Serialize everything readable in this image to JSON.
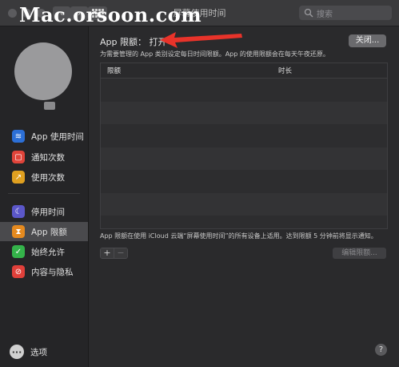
{
  "window": {
    "title": "屏幕使用时间",
    "search_placeholder": "搜索",
    "back_glyph": "‹",
    "forward_glyph": "›"
  },
  "watermark": "Mac.orsoon.com",
  "sidebar": {
    "items": [
      {
        "label": "App 使用时间",
        "icon": "layers-icon",
        "color": "#2c6fd6",
        "glyph": "≋"
      },
      {
        "label": "通知次数",
        "icon": "notification-icon",
        "color": "#e0443a",
        "glyph": "▢"
      },
      {
        "label": "使用次数",
        "icon": "pickups-icon",
        "color": "#e0a020",
        "glyph": "↗"
      },
      {
        "label": "停用时间",
        "icon": "downtime-icon",
        "color": "#5b57c9",
        "glyph": "☾"
      },
      {
        "label": "App 限额",
        "icon": "hourglass-icon",
        "color": "#e58a1f",
        "glyph": "⧗"
      },
      {
        "label": "始终允许",
        "icon": "checkmark-icon",
        "color": "#34b34a",
        "glyph": "✓"
      },
      {
        "label": "内容与隐私",
        "icon": "restriction-icon",
        "color": "#e0403a",
        "glyph": "⊘"
      }
    ],
    "selected": "App 限额",
    "options_label": "选项",
    "options_glyph": "···"
  },
  "main": {
    "heading": "App 限额：  打开",
    "off_button": "关闭...",
    "description": "为需要管理的 App 类别设定每日时间限额。App 的使用限额会在每天午夜还原。",
    "table": {
      "columns": [
        "限额",
        "时长"
      ],
      "rows": []
    },
    "footnote": "App 限额在使用 iCloud 云端“屏幕使用时间”的所有设备上适用。达到限额 5 分钟前将显示通知。",
    "add_glyph": "+",
    "remove_glyph": "−",
    "edit_button": "编辑限额...",
    "help_glyph": "?"
  },
  "colors": {
    "window_bg": "#2a2a2c",
    "sidebar_bg": "#252527",
    "selection": "#4a4a4d",
    "arrow": "#e8332a"
  }
}
